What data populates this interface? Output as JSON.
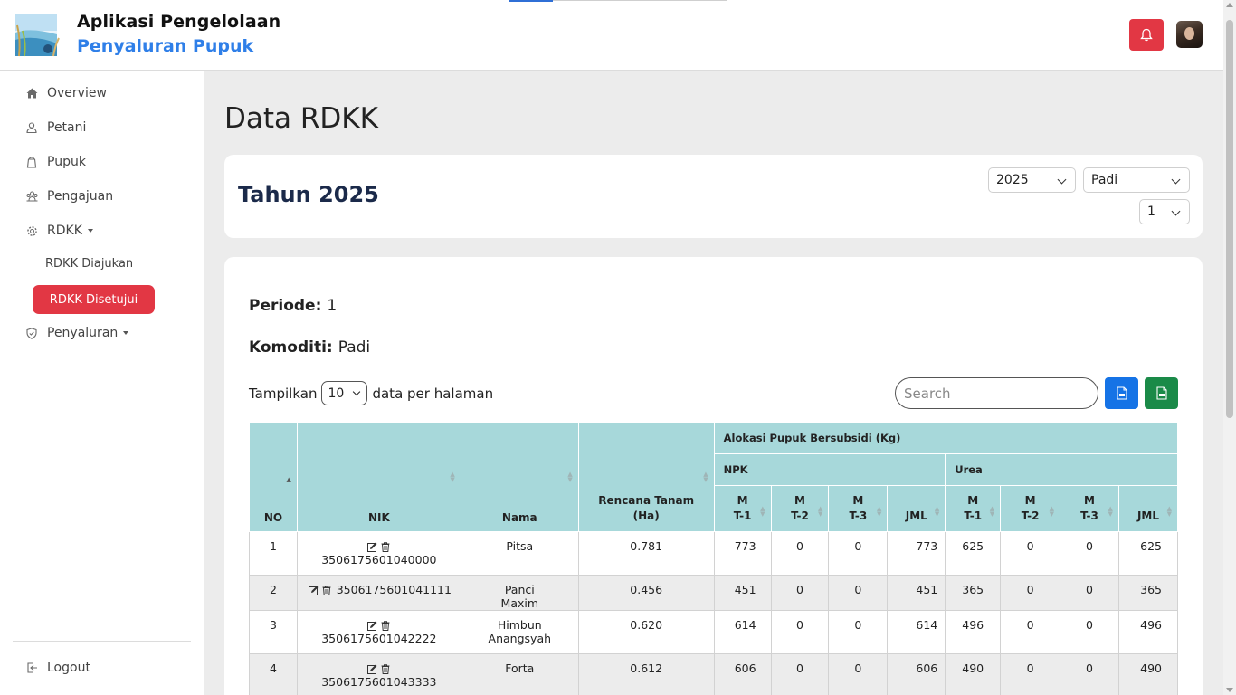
{
  "header": {
    "title_line1": "Aplikasi Pengelolaan",
    "title_line2": "Penyaluran Pupuk",
    "bell_icon": "bell-icon",
    "bell_color": "#e23744"
  },
  "sidebar": {
    "items": [
      {
        "label": "Overview",
        "icon": "home-icon"
      },
      {
        "label": "Petani",
        "icon": "user-icon"
      },
      {
        "label": "Pupuk",
        "icon": "bag-icon"
      },
      {
        "label": "Pengajuan",
        "icon": "people-icon"
      },
      {
        "label": "RDKK",
        "icon": "gear-icon"
      },
      {
        "label": "Penyaluran",
        "icon": "shield-icon"
      }
    ],
    "rdkk_sub": [
      "RDKK Diajukan",
      "RDKK Disetujui"
    ],
    "active_sub": "RDKK Disetujui",
    "logout": "Logout",
    "accent": "#e23744"
  },
  "main": {
    "page_title": "Data RDKK",
    "year_title": "Tahun 2025",
    "year_select": "2025",
    "commodity_select": "Padi",
    "period_select": "1",
    "periode_label": "Periode:",
    "periode_value": "1",
    "komoditi_label": "Komoditi:",
    "komoditi_value": "Padi",
    "show_prefix": "Tampilkan",
    "show_value": "10",
    "show_suffix": "data per halaman",
    "search_placeholder": "Search"
  },
  "table": {
    "headers": {
      "no": "NO",
      "nik": "NIK",
      "nama": "Nama",
      "rencana": "Rencana Tanam (Ha)",
      "alokasi": "Alokasi Pupuk Bersubsidi (Kg)",
      "npk": "NPK",
      "urea": "Urea",
      "mt1": "MT-1",
      "mt2": "MT-2",
      "mt3": "MT-3",
      "jml": "JML"
    },
    "rows": [
      {
        "no": "1",
        "nik": "3506175601040000",
        "nama": "Pitsa",
        "rencana": "0.781",
        "npk": [
          "773",
          "0",
          "0",
          "773"
        ],
        "urea": [
          "625",
          "0",
          "0",
          "625"
        ]
      },
      {
        "no": "2",
        "nik": "3506175601041111",
        "nama": "Panci Maxim",
        "rencana": "0.456",
        "npk": [
          "451",
          "0",
          "0",
          "451"
        ],
        "urea": [
          "365",
          "0",
          "0",
          "365"
        ]
      },
      {
        "no": "3",
        "nik": "3506175601042222",
        "nama": "Himbun Anangsyah",
        "rencana": "0.620",
        "npk": [
          "614",
          "0",
          "0",
          "614"
        ],
        "urea": [
          "496",
          "0",
          "0",
          "496"
        ]
      },
      {
        "no": "4",
        "nik": "3506175601043333",
        "nama": "Forta",
        "rencana": "0.612",
        "npk": [
          "606",
          "0",
          "0",
          "606"
        ],
        "urea": [
          "490",
          "0",
          "0",
          "490"
        ]
      }
    ]
  }
}
